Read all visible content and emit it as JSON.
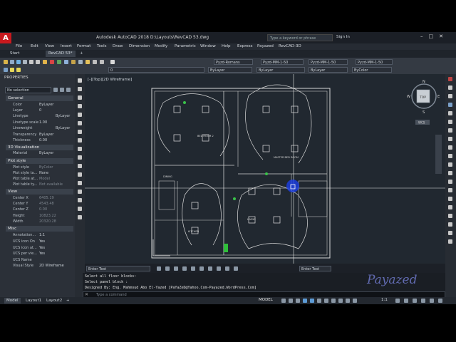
{
  "app": {
    "title": "Autodesk AutoCAD 2018   D:\\Layouts\\RevCAD 53.dwg",
    "search_placeholder": "Type a keyword or phrase",
    "signin": "Sign In",
    "logo_letter": "A"
  },
  "menu": [
    "File",
    "Edit",
    "View",
    "Insert",
    "Format",
    "Tools",
    "Draw",
    "Dimension",
    "Modify",
    "Parametric",
    "Window",
    "Help",
    "Express",
    "Payazed",
    "RevCAD-3D"
  ],
  "tabs": {
    "start": "Start",
    "doc": "RevCAD 53*"
  },
  "ribbon": {
    "layer_value": "0",
    "textstyle": "Pyzd-Romans",
    "dimstyle1": "Pyzd-MM-1-50",
    "dimstyle2": "Pyzd-MM-1-50",
    "dimstyle3": "Pyzd-MM-1-50",
    "color": "ByLayer",
    "linetype": "ByLayer",
    "lineweight": "ByLayer",
    "plotstyle": "ByColor"
  },
  "properties": {
    "header": "PROPERTIES",
    "selection": "No selection",
    "sections": {
      "general": "General",
      "viz3d": "3D Visualization",
      "plot": "Plot style",
      "view": "View",
      "misc": "Misc"
    },
    "general": [
      {
        "label": "Color",
        "value": "ByLayer"
      },
      {
        "label": "Layer",
        "value": "0"
      },
      {
        "label": "Linetype",
        "value": "ByLayer"
      },
      {
        "label": "Linetype scale",
        "value": "1.00"
      },
      {
        "label": "Lineweight",
        "value": "ByLayer"
      },
      {
        "label": "Transparency",
        "value": "ByLayer"
      },
      {
        "label": "Thickness",
        "value": "0.00"
      }
    ],
    "viz3d": [
      {
        "label": "Material",
        "value": "ByLayer"
      }
    ],
    "plot": [
      {
        "label": "Plot style",
        "value": "ByColor"
      },
      {
        "label": "Plot style ta...",
        "value": "None"
      },
      {
        "label": "Plot table at...",
        "value": "Model"
      },
      {
        "label": "Plot table ty...",
        "value": "Not available"
      }
    ],
    "view": [
      {
        "label": "Center X",
        "value": "6405.19"
      },
      {
        "label": "Center Y",
        "value": "4543.48"
      },
      {
        "label": "Center Z",
        "value": "0.00"
      },
      {
        "label": "Height",
        "value": "10823.22"
      },
      {
        "label": "Width",
        "value": "20320.28"
      }
    ],
    "misc": [
      {
        "label": "Annotation...",
        "value": "1:1"
      },
      {
        "label": "UCS icon On",
        "value": "Yes"
      },
      {
        "label": "UCS icon at...",
        "value": "Yes"
      },
      {
        "label": "UCS per vie...",
        "value": "Yes"
      },
      {
        "label": "UCS Name",
        "value": ""
      },
      {
        "label": "Visual Style",
        "value": "2D Wireframe"
      }
    ]
  },
  "viewport": {
    "label": "[-][Top][2D Wireframe]",
    "viewcube_face": "TOP",
    "compass": {
      "n": "N",
      "s": "S",
      "e": "E",
      "w": "W"
    },
    "wcs": "WCS",
    "rooms": [
      "MASTER BED ROOM",
      "BED ROOM 2",
      "DINING",
      "KITCHEN",
      "LIVING"
    ]
  },
  "command": {
    "history": [
      "Select all floor blocks:",
      "Select panel block :",
      "Designed By: Eng. Mahmoud Abo El-Yazed [PaYaZeD@Yahoo.Com-Payazed.WordPress.Com]"
    ],
    "input_placeholder": "Type a command",
    "enter_text": "Enter Text"
  },
  "bottom": {
    "tabs": [
      "Model",
      "Layout1",
      "Layout2"
    ],
    "add": "+",
    "model_button": "MODEL",
    "scale": "1:1"
  },
  "watermark": "Payazed",
  "colors": {
    "accent": "#c8191e",
    "viewport_bg": "#212830",
    "highlight": "#1b3fe8"
  }
}
